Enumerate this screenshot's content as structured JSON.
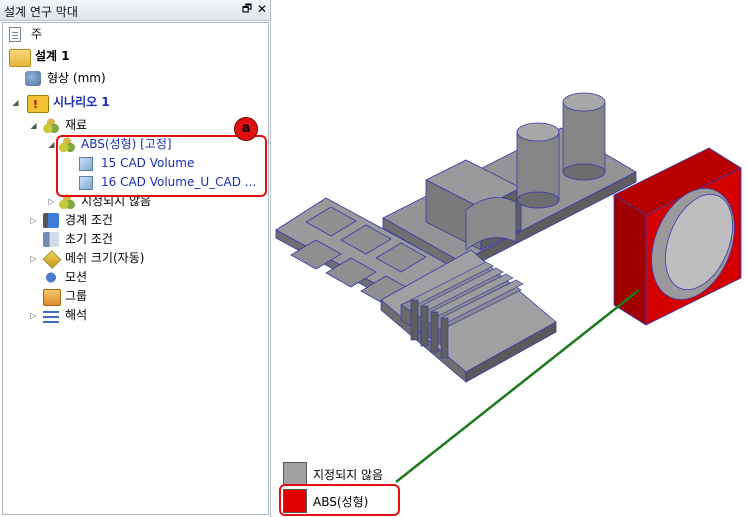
{
  "panel": {
    "title": "설계 연구 막대",
    "pin_glyph": "🗗",
    "close_glyph": "✕"
  },
  "tree": {
    "root": "주",
    "design": "설계 1",
    "geometry": "형상 (mm)",
    "scenario": "시나리오 1",
    "materials": "재료",
    "material_abs": "ABS(성형) [고정]",
    "volume1": "15 CAD Volume",
    "volume2": "16 CAD Volume_U_CAD ...",
    "unassigned": "지정되지 않음",
    "boundary": "경계 조건",
    "initial": "초기 조건",
    "mesh": "메쉬 크기(자동)",
    "motion": "모션",
    "groups": "그룹",
    "analysis": "해석"
  },
  "callout": {
    "badge": "a"
  },
  "legend": {
    "items": [
      {
        "label": "지정되지 않음",
        "color": "#a0a0a0"
      },
      {
        "label": "ABS(성형)",
        "color": "#e00000"
      }
    ]
  },
  "colors": {
    "part_gray": "#8c8c8e",
    "part_red": "#d10000",
    "leader": "#1c7a1c",
    "highlight": "#e01010",
    "tree_blue": "#1a2fb0"
  }
}
